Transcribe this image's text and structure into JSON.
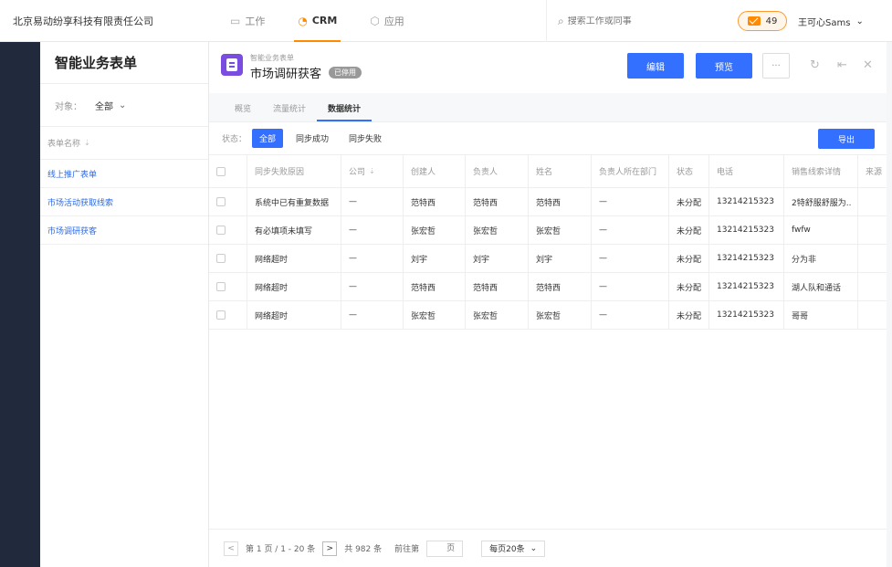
{
  "topbar": {
    "company": "北京易动纷享科技有限责任公司",
    "nav": [
      {
        "label": "工作",
        "icon": "monitor-icon"
      },
      {
        "label": "CRM",
        "icon": "pie-icon"
      },
      {
        "label": "应用",
        "icon": "cube-icon"
      }
    ],
    "search_placeholder": "搜索工作或同事",
    "msg_count": "49",
    "user": "王可心Sams",
    "accent": "#ff8a00"
  },
  "left": {
    "title": "智能业务表单",
    "filter_label": "对象：",
    "filter_value": "全部",
    "list_header": "表单名称",
    "items": [
      "线上推广表单",
      "市场活动获取线索",
      "市场调研获客"
    ]
  },
  "main": {
    "subtitle": "智能业务表单",
    "title": "市场调研获客",
    "status_tag": "已停用",
    "edit_label": "编辑",
    "preview_label": "预览",
    "more_label": "···",
    "tabs": [
      "概览",
      "流量统计",
      "数据统计"
    ],
    "status_label": "状态：",
    "chips": [
      "全部",
      "同步成功",
      "同步失败"
    ],
    "export_label": "导出",
    "primary_color": "#3370ff",
    "columns": [
      "同步失败原因",
      "公司",
      "创建人",
      "负责人",
      "姓名",
      "负责人所在部门",
      "状态",
      "电话",
      "销售线索详情",
      "来源"
    ],
    "rows": [
      [
        "系统中已有重复数据",
        "—",
        "范特西",
        "范特西",
        "范特西",
        "—",
        "未分配",
        "13214215323",
        "2特舒服舒服为.."
      ],
      [
        "有必填项未填写",
        "—",
        "张宏哲",
        "张宏哲",
        "张宏哲",
        "—",
        "未分配",
        "13214215323",
        "fwfw"
      ],
      [
        "网络超时",
        "—",
        "刘宇",
        "刘宇",
        "刘宇",
        "—",
        "未分配",
        "13214215323",
        "分为非"
      ],
      [
        "网络超时",
        "—",
        "范特西",
        "范特西",
        "范特西",
        "—",
        "未分配",
        "13214215323",
        "湖人队和通话"
      ],
      [
        "网络超时",
        "—",
        "张宏哲",
        "张宏哲",
        "张宏哲",
        "—",
        "未分配",
        "13214215323",
        "哥哥"
      ]
    ],
    "pager": {
      "page_info": "第 1 页 / 1 - 20 条",
      "total": "共 982 条",
      "goto_label": "前往第",
      "goto_unit": "页",
      "page_size": "每页20条"
    }
  }
}
